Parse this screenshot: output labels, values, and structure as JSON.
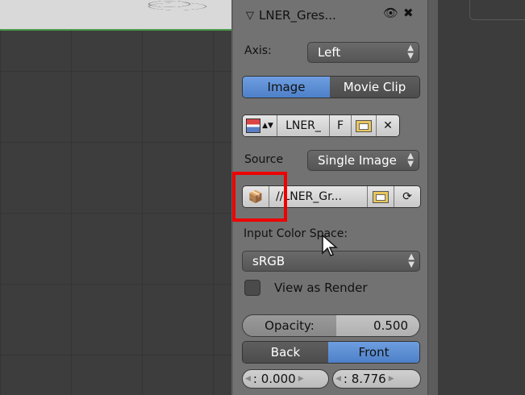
{
  "panel": {
    "title": "LNER_Gres...",
    "axis": {
      "label": "Axis:",
      "value": "Left"
    },
    "source_type": {
      "image": "Image",
      "movie_clip": "Movie Clip",
      "selected": "Image"
    },
    "image_block": {
      "name": "LNER_",
      "fake_user": "F"
    },
    "source": {
      "label": "Source",
      "value": "Single Image"
    },
    "filepath": "//LNER_Gr...",
    "color_space": {
      "label": "Input Color Space:",
      "value": "sRGB"
    },
    "view_as_render": {
      "label": "View as Render",
      "checked": false
    },
    "opacity": {
      "label": "Opacity:",
      "value": "0.500"
    },
    "depth": {
      "back": "Back",
      "front": "Front",
      "selected": "Front"
    },
    "offset": {
      "x": ": 0.000",
      "y": ": 8.776"
    }
  },
  "colors": {
    "accent": "#5b8ad4",
    "highlight": "#e00000"
  }
}
